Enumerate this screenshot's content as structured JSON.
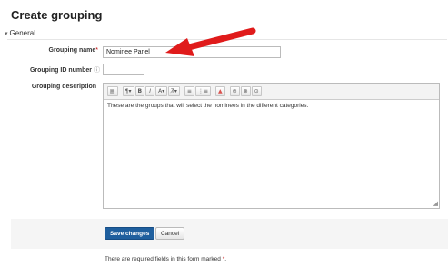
{
  "page": {
    "title": "Create grouping"
  },
  "section": {
    "toggle_icon": "caret-down-icon",
    "title": "General"
  },
  "form": {
    "grouping_name": {
      "label": "Grouping name",
      "required_marker": "*",
      "value": "Nominee Panel"
    },
    "grouping_id": {
      "label": "Grouping ID number",
      "help_icon": "?",
      "value": ""
    },
    "grouping_description": {
      "label": "Grouping description",
      "content": "These are the groups that will select the nominees in the different categories."
    }
  },
  "editor_toolbar": {
    "buttons": [
      {
        "name": "toolbar-toggle-icon",
        "glyph": "▤"
      },
      {
        "name": "paragraph-styles-icon",
        "glyph": "¶▾"
      },
      {
        "name": "bold-icon",
        "glyph": "B"
      },
      {
        "name": "italic-icon",
        "glyph": "I"
      },
      {
        "name": "text-color-icon",
        "glyph": "A▾"
      },
      {
        "name": "clear-format-icon",
        "glyph": "T̸▾"
      },
      {
        "name": "unordered-list-icon",
        "glyph": "≡"
      },
      {
        "name": "ordered-list-icon",
        "glyph": "⋮≡"
      },
      {
        "name": "image-icon",
        "glyph": "▲"
      },
      {
        "name": "link-icon",
        "glyph": "⊘"
      },
      {
        "name": "unlink-icon",
        "glyph": "⊗"
      },
      {
        "name": "media-icon",
        "glyph": "⊙"
      }
    ]
  },
  "actions": {
    "save_label": "Save changes",
    "cancel_label": "Cancel"
  },
  "footer": {
    "required_note": "There are required fields in this form marked",
    "required_marker": "*",
    "end": "."
  },
  "colors": {
    "primary_button": "#1f5f9e",
    "required": "#c00000",
    "annotation_arrow": "#e01b1b"
  }
}
